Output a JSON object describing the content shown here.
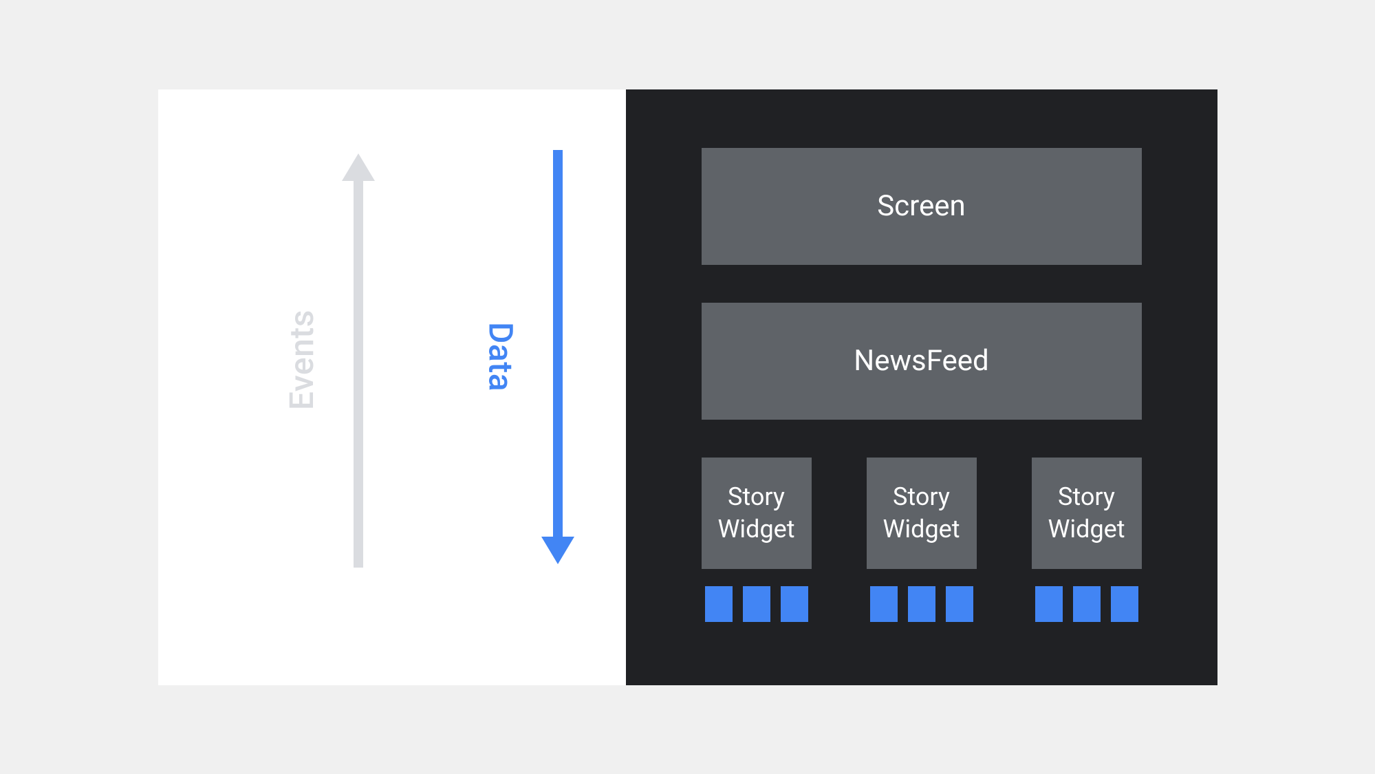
{
  "left": {
    "events_label": "Events",
    "data_label": "Data",
    "colors": {
      "events": "#dadce0",
      "data": "#4285f4"
    }
  },
  "right": {
    "screen_label": "Screen",
    "newsfeed_label": "NewsFeed",
    "story_widgets": [
      {
        "line1": "Story",
        "line2": "Widget"
      },
      {
        "line1": "Story",
        "line2": "Widget"
      },
      {
        "line1": "Story",
        "line2": "Widget"
      }
    ],
    "small_blocks_per_widget": 3,
    "colors": {
      "background": "#202124",
      "box": "#5f6368",
      "small_block": "#4285f4"
    }
  }
}
